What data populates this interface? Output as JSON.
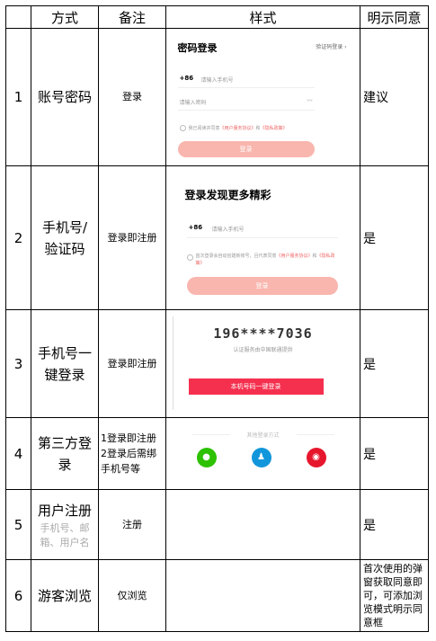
{
  "headers": [
    "",
    "方式",
    "备注",
    "样式",
    "明示同意"
  ],
  "rows": [
    {
      "num": "1",
      "method": "账号密码",
      "note": "登录",
      "consent": "建议"
    },
    {
      "num": "2",
      "method": "手机号/\n验证码",
      "note": "登录即注册",
      "consent": "是"
    },
    {
      "num": "3",
      "method": "手机号一\n键登录",
      "note": "登录即注册",
      "consent": "是"
    },
    {
      "num": "4",
      "method": "第三方登\n录",
      "note": "1登录即注册\n2登录后需绑\n手机号等",
      "consent": "是"
    },
    {
      "num": "5",
      "method": "用户注册",
      "method_sub": "手机号、邮\n箱、用户名",
      "note": "注册",
      "consent": "是"
    },
    {
      "num": "6",
      "method": "游客浏览",
      "note": "仅浏览",
      "consent": "首次使用的弹\n窗获取同意即\n可，可添加浏\n览模式明示同\n意框"
    }
  ],
  "mock_password": {
    "title": "密码登录",
    "switch_link": "验证码登录 ›",
    "country_code": "+86",
    "phone_placeholder": "请输入手机号",
    "password_placeholder": "请输入密码",
    "agree_text": "我已阅读并同意",
    "agree_link1": "《用户服务协议》",
    "agree_and": "和",
    "agree_link2": "《隐私政策》",
    "button": "登录"
  },
  "mock_sms": {
    "title": "登录发现更多精彩",
    "country_code": "+86",
    "phone_placeholder": "请输入手机号",
    "agree_text": "首次登录会自动创建新账号，且代表同意",
    "agree_link1": "《用户服务协议》",
    "agree_and": "和",
    "agree_link2": "《隐私政策》",
    "button": "登录"
  },
  "mock_onekey": {
    "masked_phone": "196****7036",
    "provider_text": "认证服务由中国联通提供",
    "button": "本机号码一键登录"
  },
  "mock_social": {
    "caption": "其他登录方式",
    "colors": {
      "wechat": "#2dc100",
      "qq": "#1296db",
      "weibo": "#e6162d"
    },
    "icons": [
      "wechat-icon",
      "qq-icon",
      "weibo-icon"
    ]
  },
  "colors": {
    "accent_pink": "#f9b6ae",
    "accent_red": "#f5304f",
    "link_red": "#e66666"
  }
}
